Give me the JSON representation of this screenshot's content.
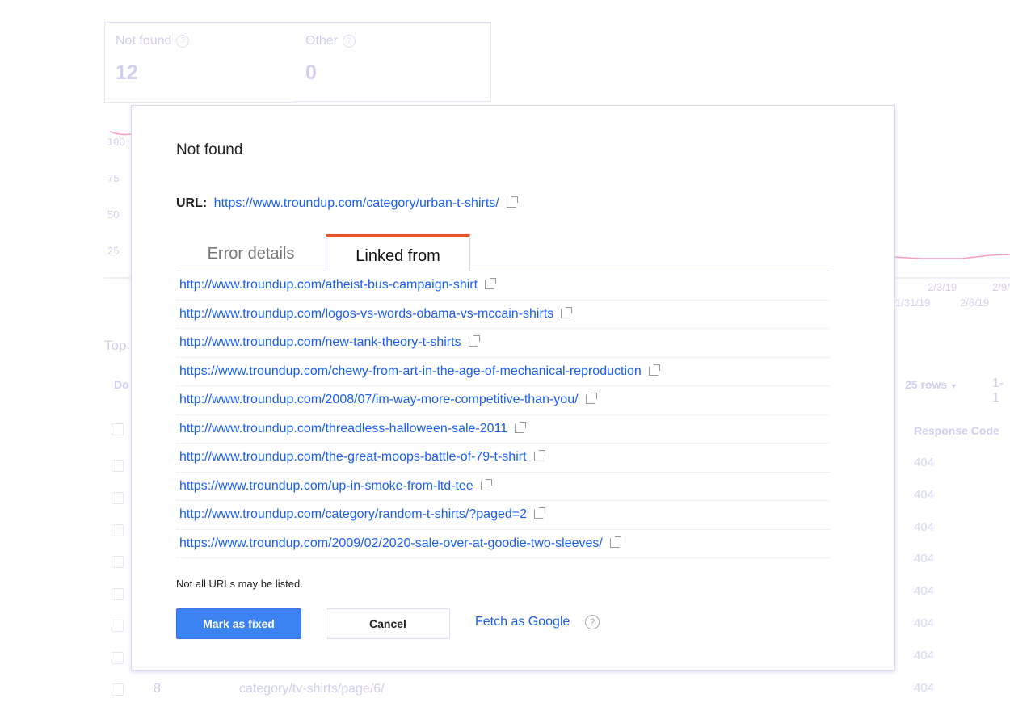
{
  "background": {
    "cards": [
      {
        "label": "Not found",
        "value": "12"
      },
      {
        "label": "Other",
        "value": "0"
      }
    ],
    "chart_data": {
      "type": "line",
      "y_ticks": [
        "100",
        "75",
        "50",
        "25"
      ],
      "x_ticks_row1": [
        "2/3/19",
        "2/9/"
      ],
      "x_ticks_row2": [
        "1/31/19",
        "2/6/19"
      ],
      "series_color": "#f5a0b8"
    },
    "section_title": "Top",
    "column_partial": "Do",
    "rows_selector": "25 rows",
    "pagination": "1-1",
    "response_code_header": "Response Code",
    "response_codes": [
      "404",
      "404",
      "404",
      "404",
      "404",
      "404",
      "404",
      "404"
    ],
    "last_row": {
      "index": "8",
      "url": "category/tv-shirts/page/6/"
    }
  },
  "modal": {
    "title": "Not found",
    "url_label": "URL:",
    "url": "https://www.troundup.com/category/urban-t-shirts/",
    "tabs": [
      {
        "label": "Error details",
        "active": false
      },
      {
        "label": "Linked from",
        "active": true
      }
    ],
    "linked_from": [
      "http://www.troundup.com/atheist-bus-campaign-shirt",
      "http://www.troundup.com/logos-vs-words-obama-vs-mccain-shirts",
      "http://www.troundup.com/new-tank-theory-t-shirts",
      "https://www.troundup.com/chewy-from-art-in-the-age-of-mechanical-reproduction",
      "http://www.troundup.com/2008/07/im-way-more-competitive-than-you/",
      "http://www.troundup.com/threadless-halloween-sale-2011",
      "http://www.troundup.com/the-great-moops-battle-of-79-t-shirt",
      "https://www.troundup.com/up-in-smoke-from-ltd-tee",
      "http://www.troundup.com/category/random-t-shirts/?paged=2",
      "https://www.troundup.com/2009/02/2020-sale-over-at-goodie-two-sleeves/"
    ],
    "note": "Not all URLs may be listed.",
    "mark_fixed": "Mark as fixed",
    "cancel": "Cancel",
    "fetch_as_google": "Fetch as Google",
    "help_icon": "?",
    "accent_color": "#e8532b",
    "primary_color": "#3b82f3"
  }
}
